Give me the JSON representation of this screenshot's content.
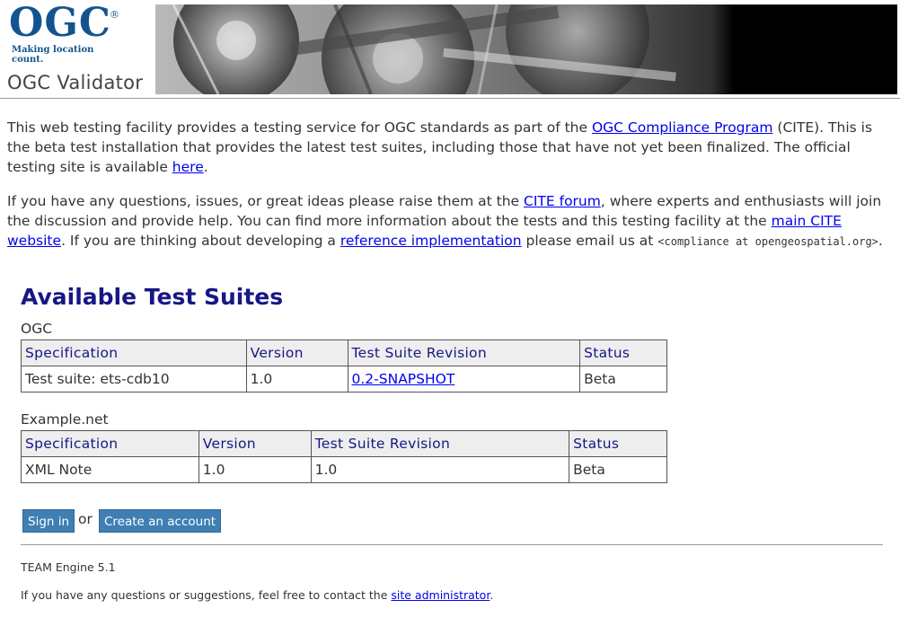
{
  "header": {
    "logo_text": "OGC",
    "logo_registered": "®",
    "logo_tagline": "Making location count.",
    "site_title": "OGC Validator"
  },
  "intro": {
    "p1_before": "This web testing facility provides a testing service for OGC standards as part of the ",
    "p1_link": "OGC Compliance Program",
    "p1_middle": " (CITE). This is the beta test installation that provides the latest test suites, including those that have not yet been finalized. The official testing site is available ",
    "p1_here": "here",
    "p1_end": ".",
    "p2_before": "If you have any questions, issues, or great ideas please raise them at the ",
    "p2_forum": "CITE forum",
    "p2_middle": ", where experts and enthusiasts will join the discussion and provide help. You can find more information about the tests and this testing facility at the ",
    "p2_main_site": "main CITE website",
    "p2_middle2": ". If you are thinking about developing a ",
    "p2_reference": "reference implementation",
    "p2_email_prefix": " please email us at ",
    "p2_email": "<compliance at opengeospatial.org>",
    "p2_end": "."
  },
  "suites": {
    "heading": "Available Test Suites",
    "groups": [
      {
        "name": "OGC",
        "columns": [
          "Specification",
          "Version",
          "Test Suite Revision",
          "Status"
        ],
        "rows": [
          {
            "specification": "Test suite: ets-cdb10",
            "version": "1.0",
            "revision": "0.2-SNAPSHOT",
            "status": "Beta"
          }
        ]
      },
      {
        "name": "Example.net",
        "columns": [
          "Specification",
          "Version",
          "Test Suite Revision",
          "Status"
        ],
        "rows": [
          {
            "specification": "XML Note",
            "version": "1.0",
            "revision": "1.0",
            "status": "Beta"
          }
        ]
      }
    ]
  },
  "auth": {
    "signin_label": "Sign in",
    "or_text": "or",
    "create_account_label": "Create an account"
  },
  "footer": {
    "version": "TEAM Engine 5.1",
    "contact_before": "If you have any questions or suggestions, feel free to contact the ",
    "contact_link": "site administrator",
    "contact_end": "."
  },
  "colors": {
    "logo_blue": "#12548f",
    "heading_navy": "#171785",
    "button_blue": "#3f7fb3",
    "link_blue": "#0000ee"
  }
}
